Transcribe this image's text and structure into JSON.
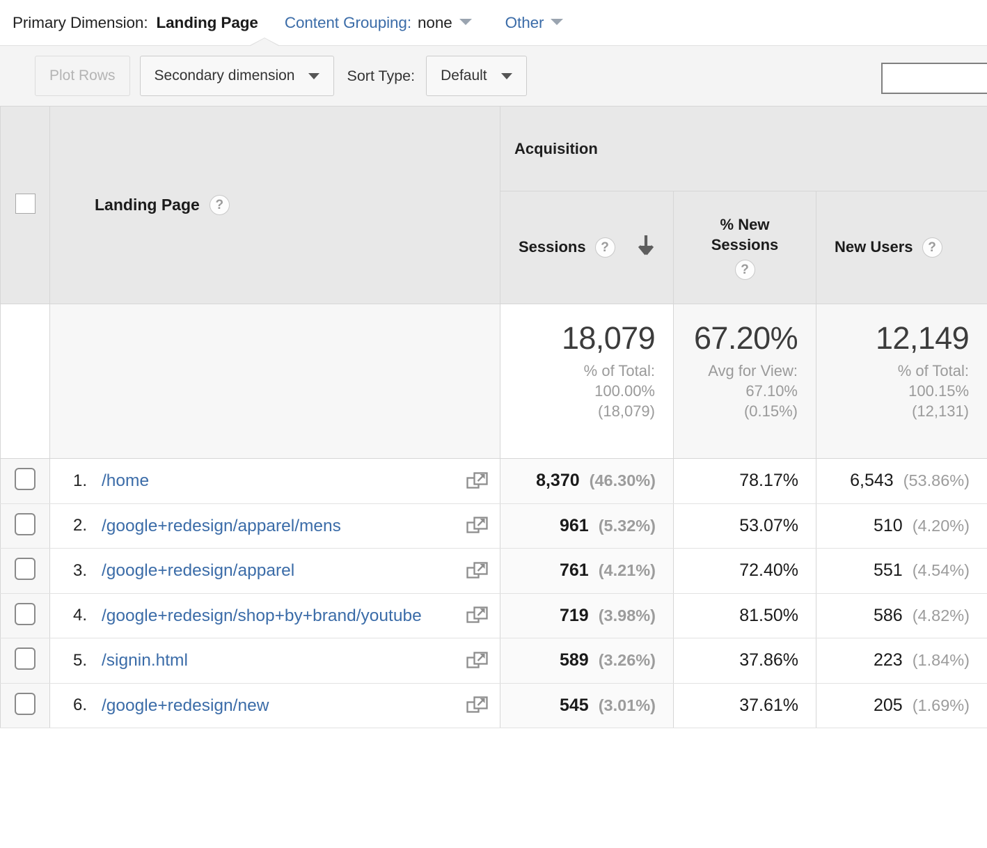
{
  "dimension_bar": {
    "primary_label": "Primary Dimension:",
    "primary_value": "Landing Page",
    "content_grouping_label": "Content Grouping:",
    "content_grouping_value": "none",
    "other_label": "Other"
  },
  "controls": {
    "plot_rows_label": "Plot Rows",
    "secondary_dimension_label": "Secondary dimension",
    "sort_type_label": "Sort Type:",
    "sort_type_value": "Default",
    "search_value": "",
    "search_placeholder": ""
  },
  "table": {
    "group_header": "Acquisition",
    "dimension_header": "Landing Page",
    "columns": [
      {
        "id": "sessions",
        "label": "Sessions",
        "sorted": true,
        "sort_direction": "desc"
      },
      {
        "id": "pct_new_sessions",
        "label": "% New\nSessions",
        "line1": "% New",
        "line2": "Sessions",
        "sorted": false
      },
      {
        "id": "new_users",
        "label": "New Users",
        "sorted": false
      }
    ],
    "totals": {
      "sessions": {
        "value": "18,079",
        "sub1": "% of Total:",
        "sub2": "100.00%",
        "sub3": "(18,079)"
      },
      "pct_new_sessions": {
        "value": "67.20%",
        "sub1": "Avg for View:",
        "sub2": "67.10%",
        "sub3": "(0.15%)"
      },
      "new_users": {
        "value": "12,149",
        "sub1": "% of Total:",
        "sub2": "100.15%",
        "sub3": "(12,131)"
      }
    },
    "rows": [
      {
        "rank": "1.",
        "landing_page": "/home",
        "sessions": "8,370",
        "sessions_pct": "(46.30%)",
        "pct_new_sessions": "78.17%",
        "new_users": "6,543",
        "new_users_pct": "(53.86%)"
      },
      {
        "rank": "2.",
        "landing_page": "/google+redesign/apparel/mens",
        "sessions": "961",
        "sessions_pct": "(5.32%)",
        "pct_new_sessions": "53.07%",
        "new_users": "510",
        "new_users_pct": "(4.20%)"
      },
      {
        "rank": "3.",
        "landing_page": "/google+redesign/apparel",
        "sessions": "761",
        "sessions_pct": "(4.21%)",
        "pct_new_sessions": "72.40%",
        "new_users": "551",
        "new_users_pct": "(4.54%)"
      },
      {
        "rank": "4.",
        "landing_page": "/google+redesign/shop+by+brand/youtube",
        "sessions": "719",
        "sessions_pct": "(3.98%)",
        "pct_new_sessions": "81.50%",
        "new_users": "586",
        "new_users_pct": "(4.82%)"
      },
      {
        "rank": "5.",
        "landing_page": "/signin.html",
        "sessions": "589",
        "sessions_pct": "(3.26%)",
        "pct_new_sessions": "37.86%",
        "new_users": "223",
        "new_users_pct": "(1.84%)"
      },
      {
        "rank": "6.",
        "landing_page": "/google+redesign/new",
        "sessions": "545",
        "sessions_pct": "(3.01%)",
        "pct_new_sessions": "37.61%",
        "new_users": "205",
        "new_users_pct": "(1.69%)"
      }
    ]
  },
  "icons": {
    "help": "?",
    "sort_desc": "down-arrow-icon",
    "open_in_new": "open-in-new-window-icon",
    "caret": "chevron-down-icon"
  },
  "colors": {
    "link": "#3b6ca8",
    "header_bg": "#e8e8e8",
    "muted_text": "#9a9a9a",
    "totals_text": "#3c3c3c"
  }
}
